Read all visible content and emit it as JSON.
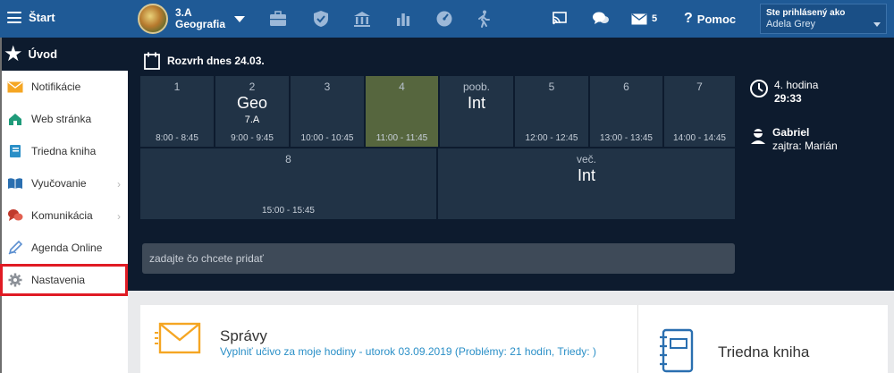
{
  "topbar": {
    "menu_label": "Štart",
    "class_name": "3.A",
    "subject": "Geografia",
    "messages_count": "5",
    "help_label": "Pomoc",
    "login_label": "Ste prihlásený ako",
    "user_name": "Adela Grey"
  },
  "sidebar": {
    "home_label": "Úvod",
    "items": [
      {
        "label": "Notifikácie",
        "icon": "envelope-icon"
      },
      {
        "label": "Web stránka",
        "icon": "house-icon"
      },
      {
        "label": "Triedna kniha",
        "icon": "book-icon"
      },
      {
        "label": "Vyučovanie",
        "icon": "open-book-icon"
      },
      {
        "label": "Komunikácia",
        "icon": "chat-icon"
      },
      {
        "label": "Agenda Online",
        "icon": "pen-icon"
      },
      {
        "label": "Nastavenia",
        "icon": "gear-icon"
      }
    ]
  },
  "schedule": {
    "heading": "Rozvrh dnes 24.03.",
    "row1": [
      {
        "num": "1",
        "subject": "",
        "room": "",
        "time": "8:00 - 8:45"
      },
      {
        "num": "2",
        "subject": "Geo",
        "room": "7.A",
        "time": "9:00 - 9:45"
      },
      {
        "num": "3",
        "subject": "",
        "room": "",
        "time": "10:00 - 10:45"
      },
      {
        "num": "4",
        "subject": "",
        "room": "",
        "time": "11:00 - 11:45"
      },
      {
        "num": "poob.",
        "subject": "Int",
        "room": "",
        "time": ""
      },
      {
        "num": "5",
        "subject": "",
        "room": "",
        "time": "12:00 - 12:45"
      },
      {
        "num": "6",
        "subject": "",
        "room": "",
        "time": "13:00 - 13:45"
      },
      {
        "num": "7",
        "subject": "",
        "room": "",
        "time": "14:00 - 14:45"
      }
    ],
    "row2": [
      {
        "num": "8",
        "subject": "",
        "room": "",
        "time": "15:00 - 15:45"
      },
      {
        "num": "več.",
        "subject": "Int",
        "room": "",
        "time": ""
      }
    ],
    "add_placeholder": "zadajte čo chcete pridať"
  },
  "side_info": {
    "lesson": "4. hodina",
    "countdown": "29:33",
    "person": "Gabriel",
    "tomorrow": "zajtra: Marián"
  },
  "cards": {
    "messages_title": "Správy",
    "messages_text": "Vyplniť učivo za moje hodiny - utorok 03.09.2019 (Problémy: 21 hodín, Triedy: )",
    "classbook_title": "Triedna kniha"
  },
  "colors": {
    "topbar": "#1f5a96",
    "dark_bg": "#0d1b2e",
    "cell": "#213346",
    "current_cell": "#56663e",
    "highlight": "#e01b24",
    "link": "#2a8fc7",
    "orange": "#f5a623"
  }
}
